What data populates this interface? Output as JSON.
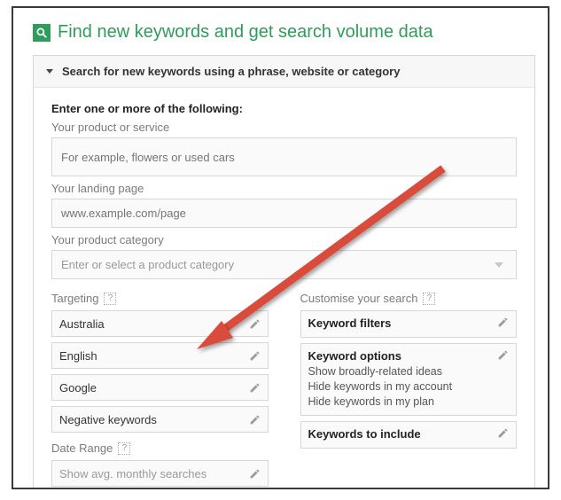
{
  "title": "Find new keywords and get search volume data",
  "panel_header": "Search for new keywords using a phrase, website or category",
  "lead": "Enter one or more of the following:",
  "product_label": "Your product or service",
  "product_placeholder": "For example, flowers or used cars",
  "landing_label": "Your landing page",
  "landing_placeholder": "www.example.com/page",
  "category_label": "Your product category",
  "category_placeholder": "Enter or select a product category",
  "targeting": {
    "label": "Targeting",
    "items": [
      "Australia",
      "English",
      "Google",
      "Negative keywords"
    ]
  },
  "date_range": {
    "label": "Date Range",
    "item": "Show avg. monthly searches"
  },
  "customise": {
    "label": "Customise your search",
    "cards": [
      {
        "title": "Keyword filters",
        "lines": []
      },
      {
        "title": "Keyword options",
        "lines": [
          "Show broadly-related ideas",
          "Hide keywords in my account",
          "Hide keywords in my plan"
        ]
      },
      {
        "title": "Keywords to include",
        "lines": []
      }
    ]
  },
  "help_glyph": "?"
}
